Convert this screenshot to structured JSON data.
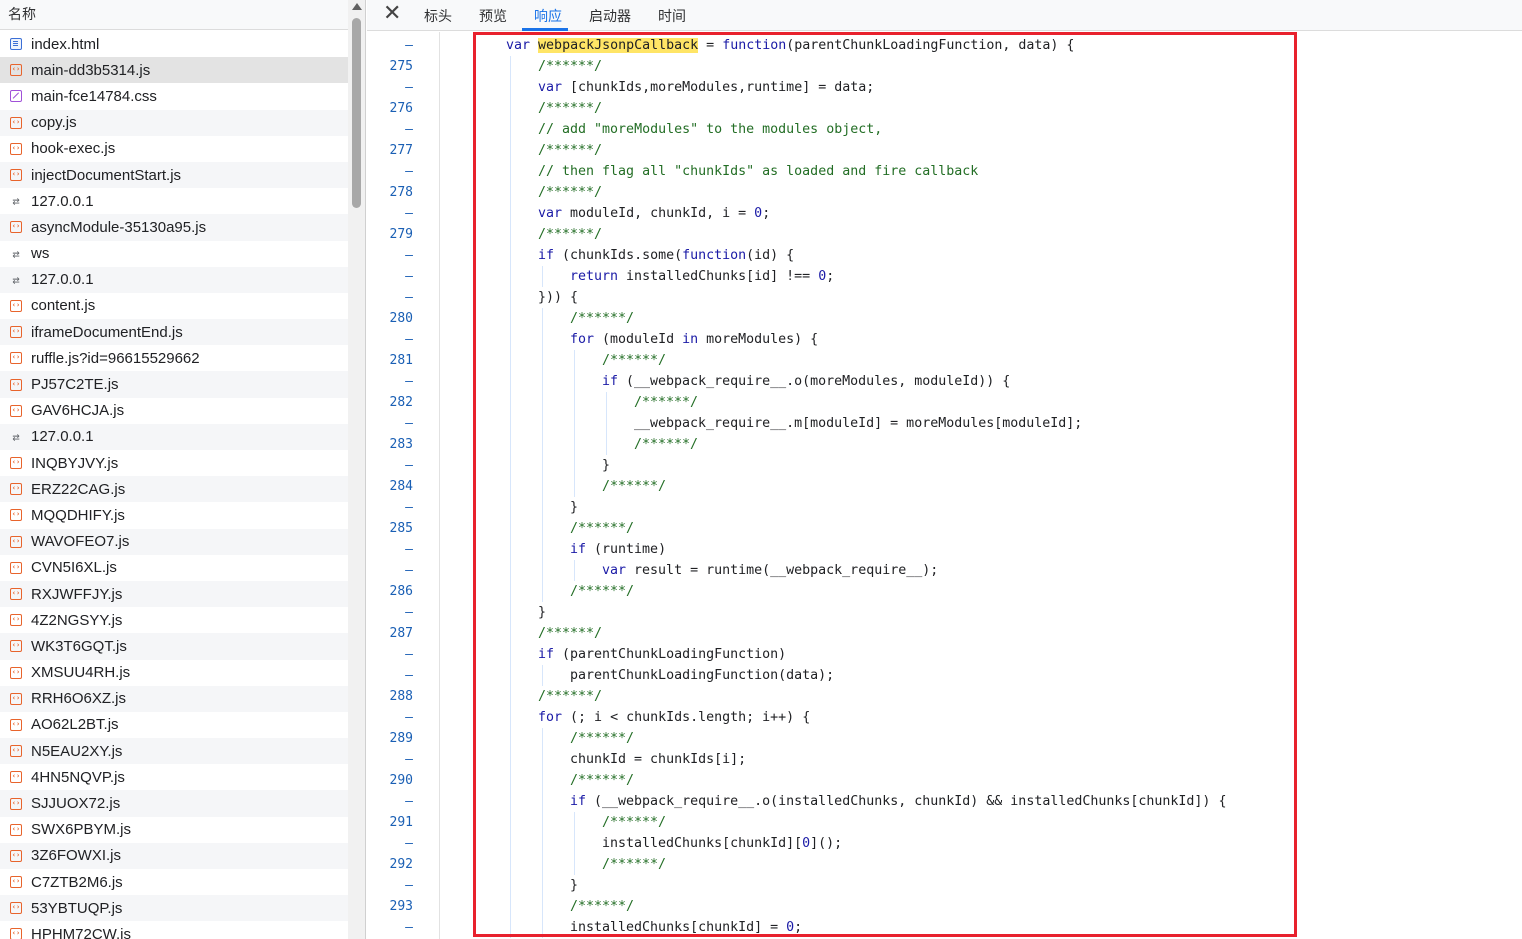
{
  "file_list": {
    "header": "名称",
    "items": [
      {
        "name": "index.html",
        "icon": "doc"
      },
      {
        "name": "main-dd3b5314.js",
        "icon": "script",
        "selected": true
      },
      {
        "name": "main-fce14784.css",
        "icon": "css"
      },
      {
        "name": "copy.js",
        "icon": "script"
      },
      {
        "name": "hook-exec.js",
        "icon": "script"
      },
      {
        "name": "injectDocumentStart.js",
        "icon": "script"
      },
      {
        "name": "127.0.0.1",
        "icon": "net"
      },
      {
        "name": "asyncModule-35130a95.js",
        "icon": "script"
      },
      {
        "name": "ws",
        "icon": "net"
      },
      {
        "name": "127.0.0.1",
        "icon": "net"
      },
      {
        "name": "content.js",
        "icon": "script"
      },
      {
        "name": "iframeDocumentEnd.js",
        "icon": "script"
      },
      {
        "name": "ruffle.js?id=96615529662",
        "icon": "script"
      },
      {
        "name": "PJ57C2TE.js",
        "icon": "script"
      },
      {
        "name": "GAV6HCJA.js",
        "icon": "script"
      },
      {
        "name": "127.0.0.1",
        "icon": "net"
      },
      {
        "name": "INQBYJVY.js",
        "icon": "script"
      },
      {
        "name": "ERZ22CAG.js",
        "icon": "script"
      },
      {
        "name": "MQQDHIFY.js",
        "icon": "script"
      },
      {
        "name": "WAVOFEO7.js",
        "icon": "script"
      },
      {
        "name": "CVN5I6XL.js",
        "icon": "script"
      },
      {
        "name": "RXJWFFJY.js",
        "icon": "script"
      },
      {
        "name": "4Z2NGSYY.js",
        "icon": "script"
      },
      {
        "name": "WK3T6GQT.js",
        "icon": "script"
      },
      {
        "name": "XMSUU4RH.js",
        "icon": "script"
      },
      {
        "name": "RRH6O6XZ.js",
        "icon": "script"
      },
      {
        "name": "AO62L2BT.js",
        "icon": "script"
      },
      {
        "name": "N5EAU2XY.js",
        "icon": "script"
      },
      {
        "name": "4HN5NQVP.js",
        "icon": "script"
      },
      {
        "name": "SJJUOX72.js",
        "icon": "script"
      },
      {
        "name": "SWX6PBYM.js",
        "icon": "script"
      },
      {
        "name": "3Z6FOWXI.js",
        "icon": "script"
      },
      {
        "name": "C7ZTB2M6.js",
        "icon": "script"
      },
      {
        "name": "53YBTUQP.js",
        "icon": "script"
      },
      {
        "name": "HPHM72CW.js",
        "icon": "script"
      }
    ]
  },
  "tabs": {
    "close_label": "✕",
    "items": [
      "标头",
      "预览",
      "响应",
      "启动器",
      "时间"
    ],
    "active_index": 2
  },
  "code_view": {
    "lines": [
      {
        "ln": "–",
        "indent": 0,
        "text": "var webpackJsonpCallback = function(parentChunkLoadingFunction, data) {"
      },
      {
        "ln": "275",
        "indent": 1,
        "text": "/******/"
      },
      {
        "ln": "–",
        "indent": 1,
        "text": "var [chunkIds,moreModules,runtime] = data;"
      },
      {
        "ln": "276",
        "indent": 1,
        "text": "/******/"
      },
      {
        "ln": "–",
        "indent": 1,
        "text": "// add \"moreModules\" to the modules object,"
      },
      {
        "ln": "277",
        "indent": 1,
        "text": "/******/"
      },
      {
        "ln": "–",
        "indent": 1,
        "text": "// then flag all \"chunkIds\" as loaded and fire callback"
      },
      {
        "ln": "278",
        "indent": 1,
        "text": "/******/"
      },
      {
        "ln": "–",
        "indent": 1,
        "text": "var moduleId, chunkId, i = 0;"
      },
      {
        "ln": "279",
        "indent": 1,
        "text": "/******/"
      },
      {
        "ln": "–",
        "indent": 1,
        "text": "if (chunkIds.some(function(id) {"
      },
      {
        "ln": "–",
        "indent": 2,
        "text": "return installedChunks[id] !== 0;"
      },
      {
        "ln": "–",
        "indent": 1,
        "text": "})) {"
      },
      {
        "ln": "280",
        "indent": 2,
        "text": "/******/"
      },
      {
        "ln": "–",
        "indent": 2,
        "text": "for (moduleId in moreModules) {"
      },
      {
        "ln": "281",
        "indent": 3,
        "text": "/******/"
      },
      {
        "ln": "–",
        "indent": 3,
        "text": "if (__webpack_require__.o(moreModules, moduleId)) {"
      },
      {
        "ln": "282",
        "indent": 4,
        "text": "/******/"
      },
      {
        "ln": "–",
        "indent": 4,
        "text": "__webpack_require__.m[moduleId] = moreModules[moduleId];"
      },
      {
        "ln": "283",
        "indent": 4,
        "text": "/******/"
      },
      {
        "ln": "–",
        "indent": 3,
        "text": "}"
      },
      {
        "ln": "284",
        "indent": 3,
        "text": "/******/"
      },
      {
        "ln": "–",
        "indent": 2,
        "text": "}"
      },
      {
        "ln": "285",
        "indent": 2,
        "text": "/******/"
      },
      {
        "ln": "–",
        "indent": 2,
        "text": "if (runtime)"
      },
      {
        "ln": "–",
        "indent": 3,
        "text": "var result = runtime(__webpack_require__);"
      },
      {
        "ln": "286",
        "indent": 2,
        "text": "/******/"
      },
      {
        "ln": "–",
        "indent": 1,
        "text": "}"
      },
      {
        "ln": "287",
        "indent": 1,
        "text": "/******/"
      },
      {
        "ln": "–",
        "indent": 1,
        "text": "if (parentChunkLoadingFunction)"
      },
      {
        "ln": "–",
        "indent": 2,
        "text": "parentChunkLoadingFunction(data);"
      },
      {
        "ln": "288",
        "indent": 1,
        "text": "/******/"
      },
      {
        "ln": "–",
        "indent": 1,
        "text": "for (; i < chunkIds.length; i++) {"
      },
      {
        "ln": "289",
        "indent": 2,
        "text": "/******/"
      },
      {
        "ln": "–",
        "indent": 2,
        "text": "chunkId = chunkIds[i];"
      },
      {
        "ln": "290",
        "indent": 2,
        "text": "/******/"
      },
      {
        "ln": "–",
        "indent": 2,
        "text": "if (__webpack_require__.o(installedChunks, chunkId) && installedChunks[chunkId]) {"
      },
      {
        "ln": "291",
        "indent": 3,
        "text": "/******/"
      },
      {
        "ln": "–",
        "indent": 3,
        "text": "installedChunks[chunkId][0]();"
      },
      {
        "ln": "292",
        "indent": 3,
        "text": "/******/"
      },
      {
        "ln": "–",
        "indent": 2,
        "text": "}"
      },
      {
        "ln": "293",
        "indent": 2,
        "text": "/******/"
      },
      {
        "ln": "–",
        "indent": 2,
        "text": "installedChunks[chunkId] = 0;"
      }
    ],
    "highlighted_term": "webpackJsonpCallback",
    "colors": {
      "keyword": "#1a1aa6",
      "comment": "#236e25",
      "search_highlight": "#ffe566",
      "annotation_box": "#e8212d",
      "active_tab": "#1a73e8"
    }
  }
}
